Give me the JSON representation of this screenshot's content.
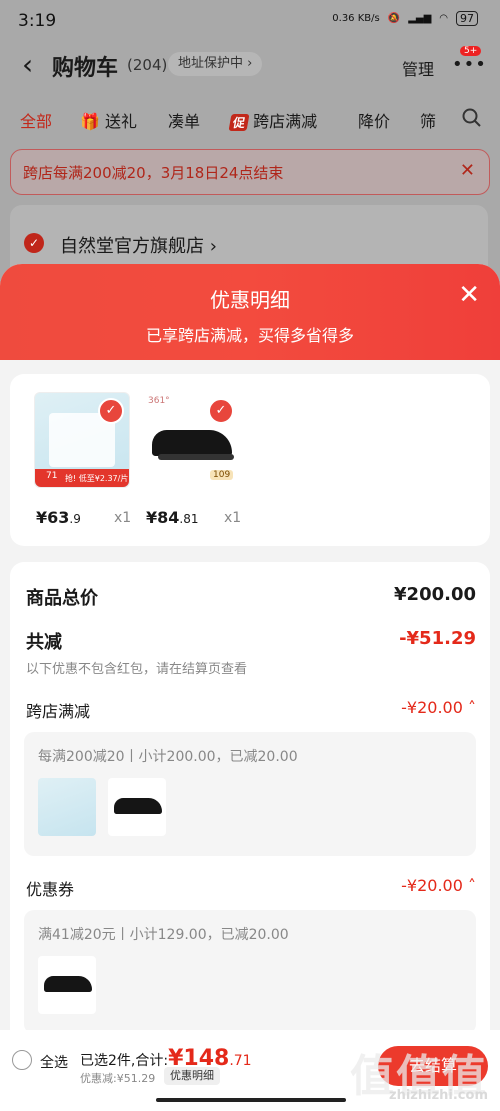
{
  "status": {
    "time": "3:19",
    "speed": "0.36 KB/s",
    "battery": "97"
  },
  "header": {
    "title": "购物车",
    "count": "(204)",
    "address": "地址保护中",
    "manage": "管理",
    "badge": "5+"
  },
  "tabs": [
    "全部",
    "送礼",
    "凑单",
    "跨店满减",
    "降价",
    "筛"
  ],
  "promo_icon": "促",
  "banner": {
    "text": "跨店每满200减20，3月18日24点结束"
  },
  "store": {
    "name": "自然堂官方旗舰店"
  },
  "sheet": {
    "title": "优惠明细",
    "subtitle": "已享跨店满减，买得多省得多",
    "products": [
      {
        "price_int": "¥63",
        "price_dec": ".9",
        "qty": "x1",
        "img": "face-mask-box",
        "tag": "71",
        "label": "抢! 低至¥2.37/片"
      },
      {
        "price_int": "¥84",
        "price_dec": ".81",
        "qty": "x1",
        "img": "black-running-shoe",
        "tag": "109",
        "brand": "361°"
      }
    ],
    "summary": {
      "total_label": "商品总价",
      "total_value": "¥200.00",
      "reduce_label": "共减",
      "reduce_value": "-¥51.29",
      "note": "以下优惠不包含红包，请在结算页查看",
      "sections": [
        {
          "label": "跨店满减",
          "value": "-¥20.00",
          "detail": "每满200减20丨小计200.00，已减20.00"
        },
        {
          "label": "优惠券",
          "value": "-¥20.00",
          "detail": "满41减20元丨小计129.00，已减20.00"
        }
      ]
    }
  },
  "bottom": {
    "select_all": "全选",
    "selected": "已选2件,合计:",
    "total_int": "¥148",
    "total_dec": ".71",
    "discount": "优惠减:¥51.29",
    "detail_btn": "优惠明细",
    "checkout": "去结算"
  },
  "watermark": {
    "big": "值值值",
    "url": "zhizhizhi.com"
  },
  "colors": {
    "accent": "#e8463c",
    "price_red": "#e4291a"
  }
}
